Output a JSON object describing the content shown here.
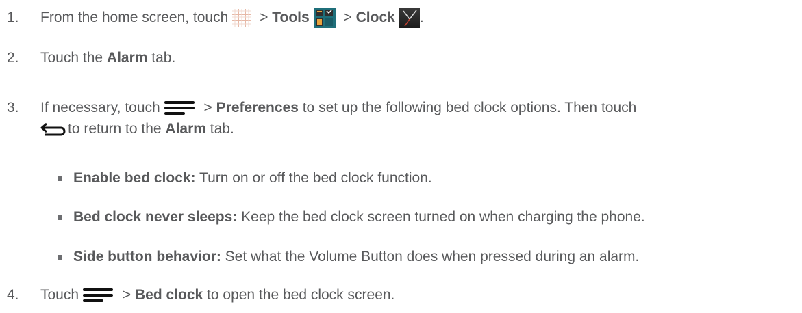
{
  "steps": [
    {
      "number": "1.",
      "parts": {
        "a": "From the home screen, touch",
        "b": " > ",
        "tools": "Tools",
        "c": " > ",
        "clock": "Clock",
        "d": "."
      },
      "icons": [
        "apps-grid-icon",
        "tools-folder-icon",
        "clock-app-icon"
      ]
    },
    {
      "number": "2.",
      "parts": {
        "a": "Touch the ",
        "alarm": "Alarm",
        "b": " tab."
      }
    },
    {
      "number": "3.",
      "parts": {
        "a": "If necessary, touch",
        "b": " > ",
        "preferences": "Preferences",
        "c": " to set up the following bed clock options. Then touch",
        "d": "to return to the ",
        "alarm": "Alarm",
        "e": " tab."
      },
      "icons": [
        "menu-icon",
        "back-icon"
      ]
    },
    {
      "number": "4.",
      "parts": {
        "a": "Touch",
        "b": " > ",
        "bedclock": "Bed clock",
        "c": " to open the bed clock screen."
      },
      "icons": [
        "menu-icon"
      ]
    }
  ],
  "bullets": [
    {
      "term": "Enable bed clock:",
      "desc": " Turn on or off the bed clock function."
    },
    {
      "term": "Bed clock never sleeps:",
      "desc": " Keep the bed clock screen turned on when charging the phone."
    },
    {
      "term": "Side button behavior:",
      "desc": " Set what the Volume Button does when pressed during an alarm."
    }
  ],
  "colors": {
    "text": "#58595b",
    "tools_icon_bg": "#1f6f7a",
    "clock_icon_bg": "#2b2b2b"
  }
}
